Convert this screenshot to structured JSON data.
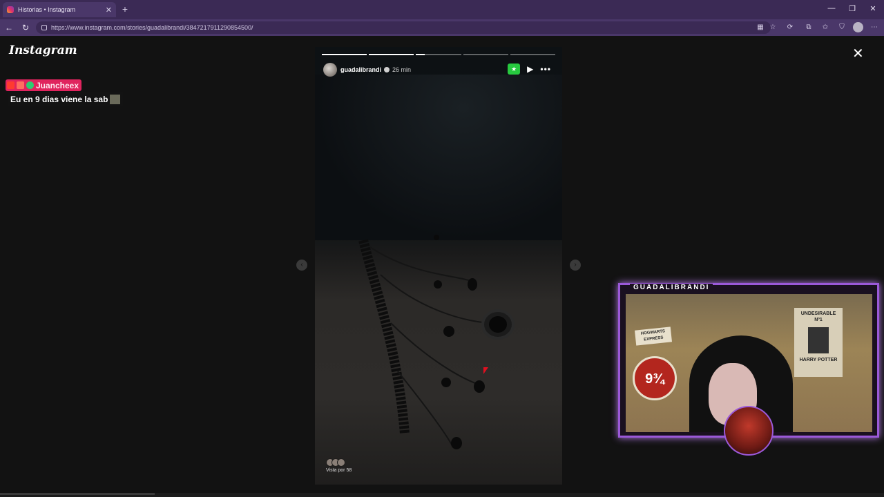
{
  "browser": {
    "tab_title": "Historias • Instagram",
    "tab_close": "✕",
    "new_tab": "+",
    "url": "https://www.instagram.com/stories/guadalibrandi/3847217911290854500/",
    "window_controls": {
      "minimize": "—",
      "restore": "❐",
      "close": "✕"
    },
    "nav": {
      "back": "←",
      "refresh": "↻"
    }
  },
  "page": {
    "logo": "Instagram",
    "close": "✕"
  },
  "chat": {
    "username": "Juancheex",
    "message": "Eu en 9 dias viene la sab",
    "badge_colors": [
      "#ff3b30",
      "#ff6f61",
      "#2ecc71"
    ]
  },
  "story": {
    "username": "guadalibrandi",
    "time": "26 min",
    "progress": [
      1.0,
      1.0,
      0.2,
      0.0,
      0.0
    ],
    "close_friends_icon": "★",
    "play_icon": "▶",
    "more_icon": "•••",
    "viewed_by": "Vista por 58",
    "prev_icon": "‹",
    "next_icon": "›"
  },
  "webcam": {
    "label": "GUADALIBRANDI",
    "poster_top": "UNDESIRABLE Nº1",
    "poster_bottom": "HARRY POTTER",
    "sign": "HOGWARTS EXPRESS",
    "platform": "9¾",
    "border_color": "#9b59d9"
  }
}
